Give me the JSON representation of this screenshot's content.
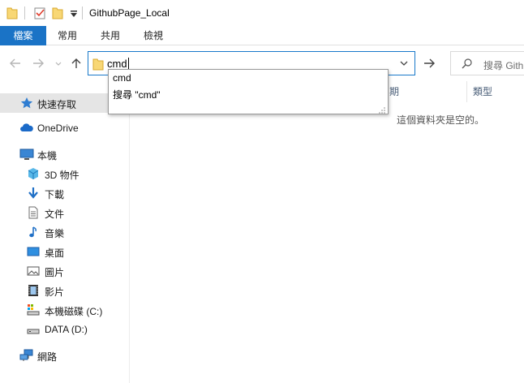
{
  "window": {
    "title": "GithubPage_Local",
    "quick_access_icons": [
      "folder-icon",
      "properties-icon",
      "new-folder-icon",
      "customize-toolbar-icon"
    ]
  },
  "ribbon": {
    "tabs": [
      {
        "label": "檔案"
      },
      {
        "label": "常用"
      },
      {
        "label": "共用"
      },
      {
        "label": "檢視"
      }
    ]
  },
  "address": {
    "value": "cmd",
    "icons": [
      "back-icon",
      "forward-icon",
      "recent-dropdown-icon",
      "up-icon",
      "folder-icon",
      "dropdown-icon",
      "go-arrow-icon"
    ]
  },
  "search": {
    "placeholder": "搜尋 Githu"
  },
  "autocomplete": {
    "options": [
      "cmd",
      "搜尋 \"cmd\""
    ]
  },
  "columns": {
    "left": "期",
    "right": "類型"
  },
  "content": {
    "empty_message": "這個資料夾是空的。"
  },
  "sidebar": {
    "items": [
      {
        "label": "快速存取",
        "icon": "star-icon"
      },
      {
        "label": "OneDrive",
        "icon": "cloud-icon"
      },
      {
        "label": "本機",
        "icon": "computer-icon"
      },
      {
        "label": "3D 物件",
        "icon": "3d-objects-icon"
      },
      {
        "label": "下載",
        "icon": "download-icon"
      },
      {
        "label": "文件",
        "icon": "document-icon"
      },
      {
        "label": "音樂",
        "icon": "music-icon"
      },
      {
        "label": "桌面",
        "icon": "desktop-icon"
      },
      {
        "label": "圖片",
        "icon": "pictures-icon"
      },
      {
        "label": "影片",
        "icon": "video-icon"
      },
      {
        "label": "本機磁碟 (C:)",
        "icon": "drive-c-icon"
      },
      {
        "label": "DATA (D:)",
        "icon": "drive-d-icon"
      },
      {
        "label": "網路",
        "icon": "network-icon"
      }
    ]
  },
  "colors": {
    "accent": "#1a73c6",
    "address_border": "#1979ca",
    "selection": "#e5e5e5",
    "folder": "#f8d775"
  }
}
